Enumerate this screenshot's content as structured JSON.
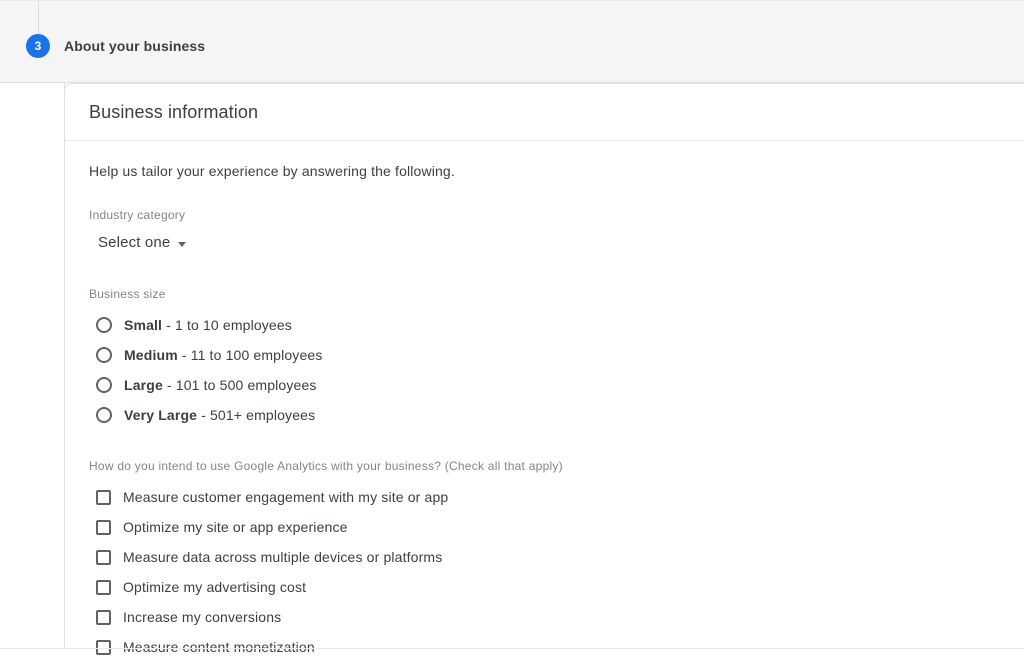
{
  "step": {
    "number": "3",
    "title": "About your business"
  },
  "card": {
    "title": "Business information",
    "intro": "Help us tailor your experience by answering the following.",
    "industry": {
      "label": "Industry category",
      "selected": "Select one",
      "caret_icon": "chevron-down-icon"
    },
    "business_size": {
      "label": "Business size",
      "options": [
        {
          "name": "Small",
          "detail": " - 1 to 10 employees"
        },
        {
          "name": "Medium",
          "detail": " - 11 to 100 employees"
        },
        {
          "name": "Large",
          "detail": " - 101 to 500 employees"
        },
        {
          "name": "Very Large",
          "detail": " - 501+ employees"
        }
      ]
    },
    "intent": {
      "label": "How do you intend to use Google Analytics with your business? (Check all that apply)",
      "options": [
        "Measure customer engagement with my site or app",
        "Optimize my site or app experience",
        "Measure data across multiple devices or platforms",
        "Optimize my advertising cost",
        "Increase my conversions",
        "Measure content monetization"
      ]
    }
  },
  "colors": {
    "accent": "#1a73e8",
    "band": "#f5f5f5",
    "text": "#3c4043",
    "muted": "#80868b",
    "border": "#e0e0e0"
  }
}
